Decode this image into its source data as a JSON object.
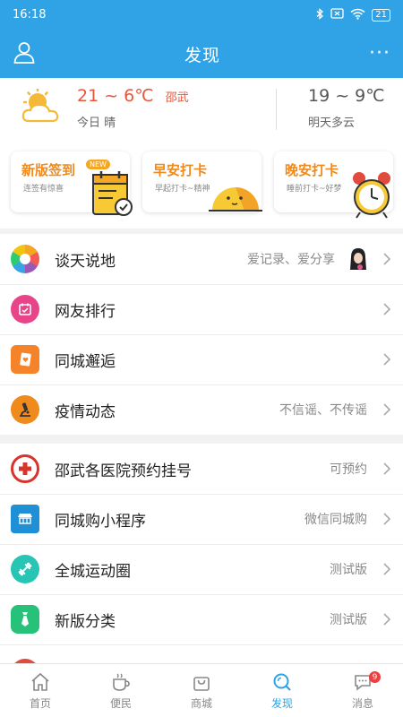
{
  "status": {
    "time": "16:18",
    "battery": "21"
  },
  "header": {
    "title": "发现"
  },
  "weather": {
    "today_temp": "21 ~ 6℃",
    "city": "邵武",
    "today_desc": "今日 晴",
    "tomorrow_temp": "19 ~ 9℃",
    "tomorrow_desc": "明天多云"
  },
  "cards": [
    {
      "title": "新版签到",
      "subtitle": "连签有惊喜",
      "badge": "NEW"
    },
    {
      "title": "早安打卡",
      "subtitle": "早起打卡~精神"
    },
    {
      "title": "晚安打卡",
      "subtitle": "睡前打卡~好梦"
    }
  ],
  "group1": [
    {
      "label": "谈天说地",
      "hint": "爱记录、爱分享",
      "icon": "aperture-icon",
      "color": "#f5a623"
    },
    {
      "label": "网友排行",
      "hint": "",
      "icon": "calendar-icon",
      "color": "#e8448a"
    },
    {
      "label": "同城邂逅",
      "hint": "",
      "icon": "card-icon",
      "color": "#f5832a"
    },
    {
      "label": "疫情动态",
      "hint": "不信谣、不传谣",
      "icon": "microscope-icon",
      "color": "#f08a1c"
    }
  ],
  "group2": [
    {
      "label": "邵武各医院预约挂号",
      "hint": "可预约",
      "icon": "hospital-icon",
      "color": "#d9342b"
    },
    {
      "label": "同城购小程序",
      "hint": "微信同城购",
      "icon": "shop-icon",
      "color": "#1f8fd6"
    },
    {
      "label": "全城运动圈",
      "hint": "测试版",
      "icon": "dumbbell-icon",
      "color": "#26c5b4"
    },
    {
      "label": "新版分类",
      "hint": "测试版",
      "icon": "tie-icon",
      "color": "#27c17a"
    }
  ],
  "tabs": [
    {
      "label": "首页",
      "icon": "home-icon"
    },
    {
      "label": "便民",
      "icon": "cup-icon"
    },
    {
      "label": "商城",
      "icon": "bag-icon"
    },
    {
      "label": "发现",
      "icon": "search-icon"
    },
    {
      "label": "消息",
      "icon": "message-icon",
      "badge": "9"
    }
  ],
  "colors": {
    "primary": "#2fa3e6",
    "accent": "#f08a1c",
    "temp": "#e4573b"
  }
}
